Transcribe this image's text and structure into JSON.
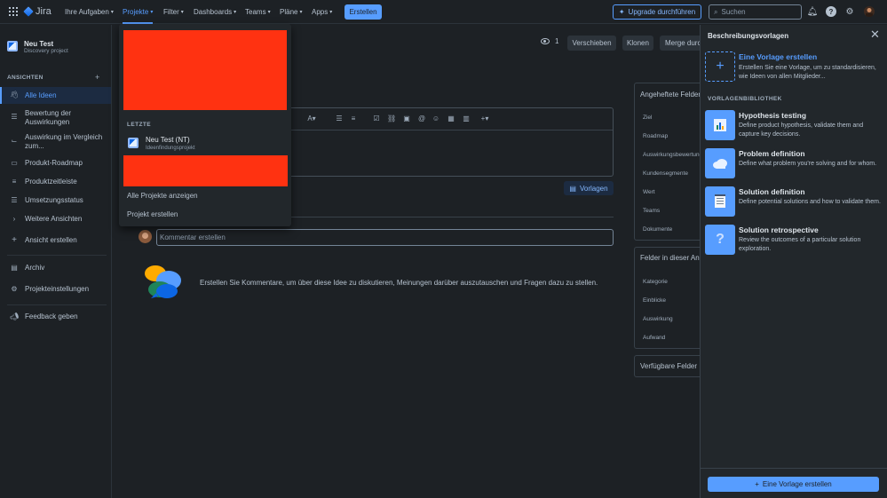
{
  "topnav": {
    "app_name": "Jira",
    "items": [
      {
        "label": "Ihre Aufgaben"
      },
      {
        "label": "Projekte"
      },
      {
        "label": "Filter"
      },
      {
        "label": "Dashboards"
      },
      {
        "label": "Teams"
      },
      {
        "label": "Pläne"
      },
      {
        "label": "Apps"
      }
    ],
    "create_label": "Erstellen",
    "upgrade_label": "Upgrade durchführen",
    "search_placeholder": "Suchen"
  },
  "sidebar": {
    "project_name": "Neu Test",
    "project_type": "Discovery project",
    "section_title": "ANSICHTEN",
    "items": [
      {
        "label": "Alle Ideen",
        "icon": "wave-hand-icon"
      },
      {
        "label": "Bewertung der Auswirkungen",
        "icon": "list-icon"
      },
      {
        "label": "Auswirkung im Vergleich zum...",
        "icon": "chart-icon"
      },
      {
        "label": "Produkt-Roadmap",
        "icon": "board-icon"
      },
      {
        "label": "Produktzeitleiste",
        "icon": "timeline-icon"
      },
      {
        "label": "Umsetzungsstatus",
        "icon": "list-icon"
      },
      {
        "label": "Weitere Ansichten",
        "icon": "chevron-right-icon"
      },
      {
        "label": "Ansicht erstellen",
        "icon": "plus-icon"
      }
    ],
    "archive_label": "Archiv",
    "settings_label": "Projekteinstellungen",
    "feedback_label": "Feedback geben"
  },
  "main": {
    "watch_count": "1",
    "buttons": {
      "move": "Verschieben",
      "clone": "Klonen",
      "merge": "Merge durch"
    },
    "templates_button": "Vorlagen",
    "comment_placeholder": "Kommentar erstellen",
    "empty_comments_text": "Erstellen Sie Kommentare, um über diese Idee zu diskutieren, Meinungen darüber auszutauschen und Fragen dazu zu stellen."
  },
  "fields": {
    "pinned_title": "Angeheftete Felder",
    "pinned": [
      "Ziel",
      "Roadmap",
      "Auswirkungsbewertung",
      "Kundensegmente",
      "Wert",
      "Teams",
      "Dokumente"
    ],
    "in_view_title": "Felder in dieser Ansicht",
    "in_view": [
      "Kategorie",
      "Einblicke",
      "Auswirkung",
      "Aufwand"
    ],
    "available_title": "Verfügbare Felder"
  },
  "projects_dropdown": {
    "recent_label": "LETZTE",
    "recent_project_name": "Neu Test (NT)",
    "recent_project_type": "Ideenfindungsprojekt",
    "view_all": "Alle Projekte anzeigen",
    "create_project": "Projekt erstellen"
  },
  "templates_panel": {
    "title": "Beschreibungsvorlagen",
    "create_title": "Eine Vorlage erstellen",
    "create_desc": "Erstellen Sie eine Vorlage, um zu standardisieren, wie Ideen von allen Mitglieder...",
    "library_label": "VORLAGENBIBLIOTHEK",
    "templates": [
      {
        "title": "Hypothesis testing",
        "desc": "Define product hypothesis, validate them and capture key decisions.",
        "icon": "chart-board-icon"
      },
      {
        "title": "Problem definition",
        "desc": "Define what problem you're solving and for whom.",
        "icon": "cloud-icon"
      },
      {
        "title": "Solution definition",
        "desc": "Define potential solutions and how to validate them.",
        "icon": "notepad-icon"
      },
      {
        "title": "Solution retrospective",
        "desc": "Review the outcomes of a particular solution exploration.",
        "icon": "question-icon"
      }
    ],
    "footer_button": "Eine Vorlage erstellen"
  },
  "colors": {
    "accent": "#579dff",
    "background": "#1d2125",
    "redaction": "#ff3211"
  }
}
